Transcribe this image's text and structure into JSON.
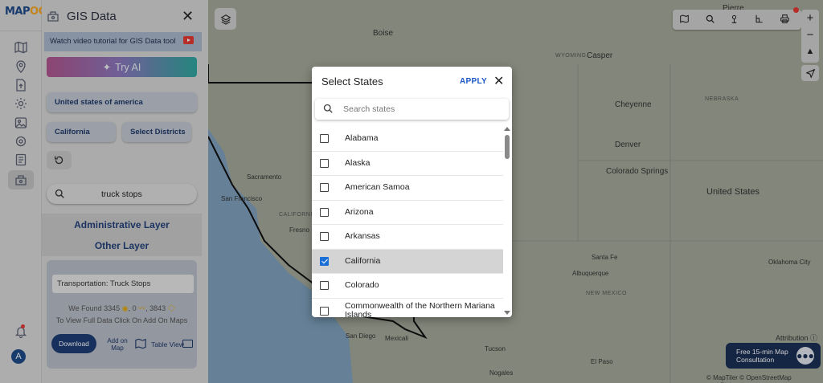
{
  "app": {
    "logo": "MAPOG",
    "panel_title": "GIS Data"
  },
  "sidebar": {
    "icons": [
      "map-icon",
      "pin-icon",
      "file-upload-icon",
      "gear-icon",
      "image-icon",
      "settings-icon",
      "report-icon",
      "gis-data-icon"
    ],
    "active": "gis-data-icon",
    "avatar_letter": "A"
  },
  "panel": {
    "video_tutorial": "Watch video tutorial for GIS Data tool",
    "try_ai": "Try AI",
    "country": "United states of america",
    "state": "California",
    "district": "Select Districts",
    "search_value": "truck stops",
    "admin_layer": "Administrative Layer",
    "other_layer": "Other Layer",
    "result_title": "Transportation: Truck Stops",
    "found_label": "We Found",
    "found_counts": [
      "3345",
      "0",
      "3843"
    ],
    "hint": "To View Full Data Click On Add On Maps",
    "download": "Download",
    "add_on_map": "Add on Map",
    "table_view": "Table View"
  },
  "map": {
    "labels": [
      {
        "text": "Pierre",
        "cls": "ml"
      },
      {
        "text": "Boise",
        "cls": "ml"
      },
      {
        "text": "Casper",
        "cls": "ml"
      },
      {
        "text": "WYOMING",
        "cls": "ms"
      },
      {
        "text": "NEBRASKA",
        "cls": "ms"
      },
      {
        "text": "Cheyenne",
        "cls": "ml"
      },
      {
        "text": "Denver",
        "cls": "ml"
      },
      {
        "text": "Colorado Springs",
        "cls": "ml"
      },
      {
        "text": "United States",
        "cls": "ml"
      },
      {
        "text": "Sacramento",
        "cls": "ml"
      },
      {
        "text": "San Francisco",
        "cls": "ml"
      },
      {
        "text": "CALIFORNIA",
        "cls": "ms"
      },
      {
        "text": "Fresno",
        "cls": "ml"
      },
      {
        "text": "Santa Fe",
        "cls": "ml"
      },
      {
        "text": "Albuquerque",
        "cls": "ml"
      },
      {
        "text": "Oklahoma City",
        "cls": "ml"
      },
      {
        "text": "NEW MEXICO",
        "cls": "ms"
      },
      {
        "text": "San Diego",
        "cls": "ml"
      },
      {
        "text": "Mexicali",
        "cls": "ml"
      },
      {
        "text": "Tucson",
        "cls": "ml"
      },
      {
        "text": "El Paso",
        "cls": "ml"
      },
      {
        "text": "Nogales",
        "cls": "ml"
      }
    ],
    "attribution": "Attribution",
    "copyright": "© MapTiler © OpenStreetMap contributors",
    "consult_line1": "Free 15-min Map",
    "consult_line2": "Consultation"
  },
  "modal": {
    "title": "Select States",
    "apply": "APPLY",
    "search_placeholder": "Search states",
    "states": [
      {
        "name": "Alabama",
        "checked": false
      },
      {
        "name": "Alaska",
        "checked": false
      },
      {
        "name": "American Samoa",
        "checked": false
      },
      {
        "name": "Arizona",
        "checked": false
      },
      {
        "name": "Arkansas",
        "checked": false
      },
      {
        "name": "California",
        "checked": true
      },
      {
        "name": "Colorado",
        "checked": false
      },
      {
        "name": "Commonwealth of the Northern Mariana Islands",
        "checked": false
      }
    ]
  },
  "colors": {
    "accent": "#1a56c4",
    "brand": "#1f4a8a",
    "check": "#1a6fd6"
  }
}
